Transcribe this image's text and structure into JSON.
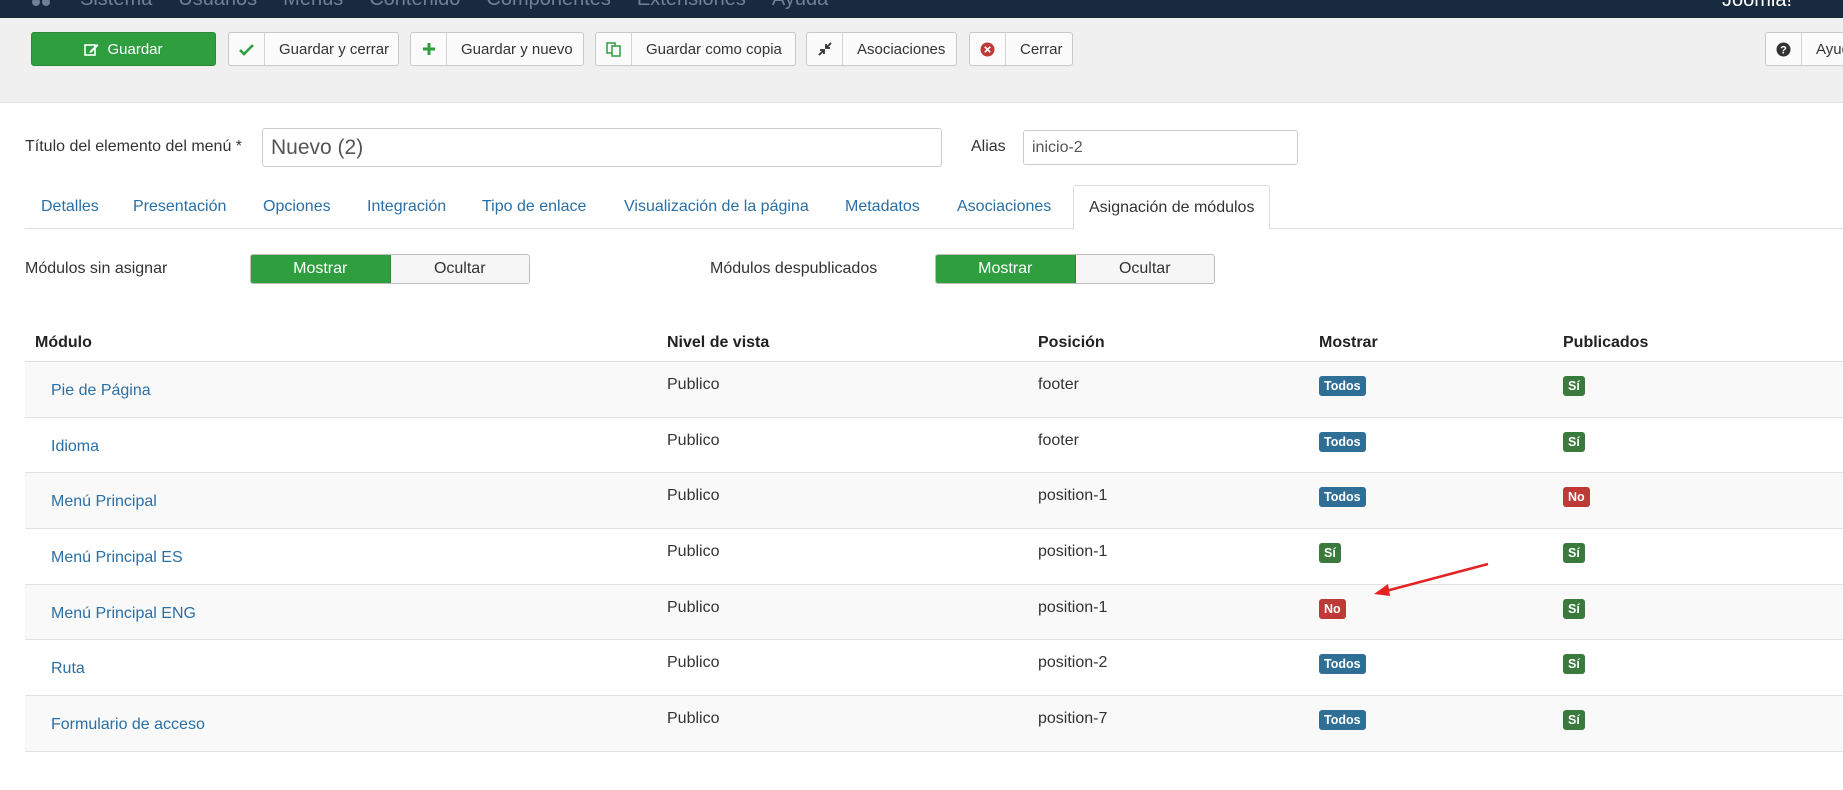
{
  "topnav": {
    "menu": [
      "Sistema",
      "Usuarios",
      "Menús",
      "Contenido",
      "Componentes",
      "Extensiones",
      "Ayuda"
    ],
    "brand": "Joomla!"
  },
  "toolbar": {
    "save": "Guardar",
    "save_close": "Guardar y cerrar",
    "save_new": "Guardar y nuevo",
    "save_copy": "Guardar como copia",
    "associations": "Asociaciones",
    "close": "Cerrar",
    "help": "Ayuda"
  },
  "form": {
    "title_label": "Título del elemento del menú *",
    "title_value": "Nuevo (2)",
    "alias_label": "Alias",
    "alias_value": "inicio-2"
  },
  "tabs": [
    "Detalles",
    "Presentación",
    "Opciones",
    "Integración",
    "Tipo de enlace",
    "Visualización de la página",
    "Metadatos",
    "Asociaciones",
    "Asignación de módulos"
  ],
  "filters": {
    "unassigned_label": "Módulos sin asignar",
    "unpublished_label": "Módulos despublicados",
    "show": "Mostrar",
    "hide": "Ocultar"
  },
  "table": {
    "headers": [
      "Módulo",
      "Nivel de vista",
      "Posición",
      "Mostrar",
      "Publicados"
    ],
    "rows": [
      {
        "name": "Pie de Página",
        "level": "Publico",
        "position": "footer",
        "show": "Todos",
        "published": "Sí"
      },
      {
        "name": "Idioma",
        "level": "Publico",
        "position": "footer",
        "show": "Todos",
        "published": "Sí"
      },
      {
        "name": "Menú Principal",
        "level": "Publico",
        "position": "position-1",
        "show": "Todos",
        "published": "No"
      },
      {
        "name": "Menú Principal ES",
        "level": "Publico",
        "position": "position-1",
        "show": "Sí",
        "published": "Sí"
      },
      {
        "name": "Menú Principal ENG",
        "level": "Publico",
        "position": "position-1",
        "show": "No",
        "published": "Sí"
      },
      {
        "name": "Ruta",
        "level": "Publico",
        "position": "position-2",
        "show": "Todos",
        "published": "Sí"
      },
      {
        "name": "Formulario de acceso",
        "level": "Publico",
        "position": "position-7",
        "show": "Todos",
        "published": "Sí"
      }
    ]
  },
  "colors": {
    "todos": "#2f6f96",
    "yes": "#3a7a3c",
    "no": "#bd3a37",
    "primary": "#2f9e3f",
    "link": "#2a6fa5"
  }
}
